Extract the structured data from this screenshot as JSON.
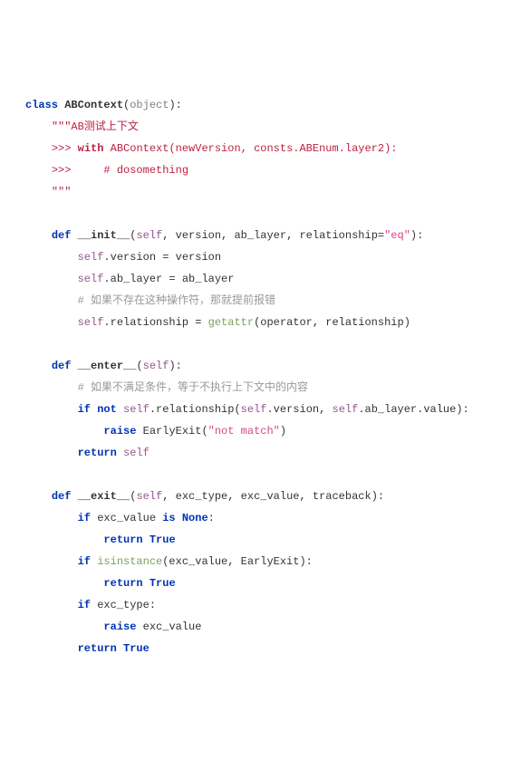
{
  "t": {
    "kw_class": "class",
    "cls_name": "ABContext",
    "base": "object",
    "doc_open": "\"\"\"",
    "doc_title": "AB测试上下文",
    "doc_ex1a": ">>> ",
    "doc_ex1_with": "with",
    "doc_ex1_rest": " ABContext(newVersion, consts.ABEnum.layer2):",
    "doc_ex2": ">>>     # dosomething",
    "doc_close": "\"\"\"",
    "kw_def1": "def",
    "init": "__init__",
    "init_args_open": "(",
    "init_self": "self",
    "init_args_mid": ", version, ab_layer, relationship=",
    "init_default": "\"eq\"",
    "init_args_close": "):",
    "l_self1": "self",
    "l_ver_assign": ".version = version",
    "l_self2": "self",
    "l_ab_assign": ".ab_layer = ab_layer",
    "cmt1": "# 如果不存在这种操作符，那就提前报错",
    "l_self3": "self",
    "l_rel_assign_a": ".relationship = ",
    "getattr": "getattr",
    "l_rel_assign_b": "(operator, relationship)",
    "kw_def2": "def",
    "enter": "__enter__",
    "enter_args_open": "(",
    "enter_self": "self",
    "enter_args_close": "):",
    "cmt2": "# 如果不满足条件，等于不执行上下文中的内容",
    "kw_if1": "if",
    "kw_not": "not",
    "enter_self2": "self",
    "cond_mid": ".relationship(",
    "enter_self3": "self",
    "cond_mid2": ".version, ",
    "enter_self4": "self",
    "cond_rest": ".ab_layer.value):",
    "kw_raise1": "raise",
    "raise_expr": " EarlyExit(",
    "raise_str": "\"not match\"",
    "raise_close": ")",
    "kw_return1": "return",
    "ret_self1": " self",
    "kw_def3": "def",
    "exit": "__exit__",
    "exit_args_open": "(",
    "exit_self": "self",
    "exit_args_rest": ", exc_type, exc_value, traceback):",
    "kw_if2": "if",
    "cond2a": " exc_value ",
    "kw_is": "is",
    "sp": " ",
    "none": "None",
    "colon": ":",
    "kw_return2": "return",
    "true2": "True",
    "kw_if3": "if",
    "isinstance": "isinstance",
    "cond3": "(exc_value, EarlyExit):",
    "kw_return3": "return",
    "true3": "True",
    "kw_if4": "if",
    "cond4": " exc_type:",
    "kw_raise2": "raise",
    "raise2_rest": " exc_value",
    "kw_return4": "return",
    "true4": "True"
  }
}
